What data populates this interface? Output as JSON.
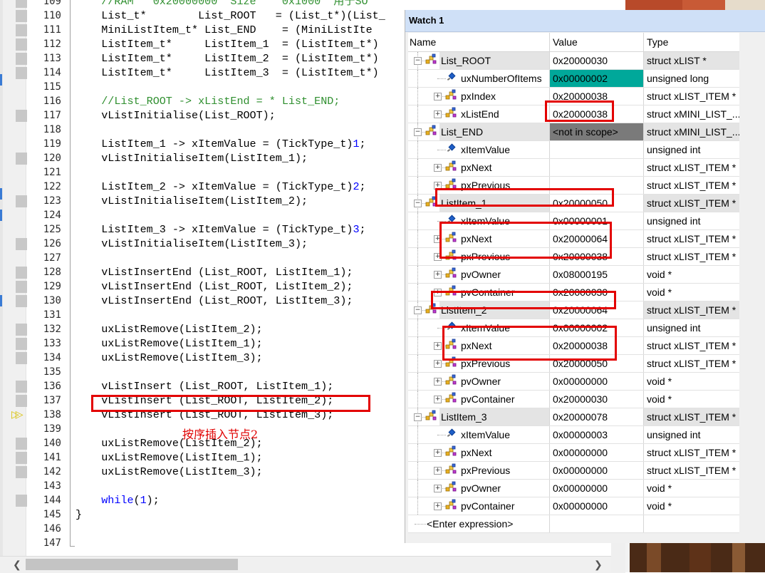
{
  "editor": {
    "lines": [
      {
        "n": "109",
        "code": [
          {
            "t": "    //RAM   0x20000000  Size    0x1000  用于SO",
            "c": "cm"
          }
        ]
      },
      {
        "n": "110",
        "code": [
          {
            "t": "    List_t*        List_ROOT   = (List_t*)(List_"
          }
        ]
      },
      {
        "n": "111",
        "code": [
          {
            "t": "    MiniListItem_t* List_END    = (MiniListIte"
          }
        ]
      },
      {
        "n": "112",
        "code": [
          {
            "t": "    ListItem_t*     ListItem_1  = (ListItem_t*)"
          }
        ]
      },
      {
        "n": "113",
        "code": [
          {
            "t": "    ListItem_t*     ListItem_2  = (ListItem_t*)"
          }
        ]
      },
      {
        "n": "114",
        "code": [
          {
            "t": "    ListItem_t*     ListItem_3  = (ListItem_t*)"
          }
        ]
      },
      {
        "n": "115",
        "code": [
          {
            "t": ""
          }
        ]
      },
      {
        "n": "116",
        "code": [
          {
            "t": "    //List_ROOT -> xListEnd = * List_END;",
            "c": "cm"
          }
        ]
      },
      {
        "n": "117",
        "code": [
          {
            "t": "    vListInitialise(List_ROOT);"
          }
        ]
      },
      {
        "n": "118",
        "code": [
          {
            "t": ""
          }
        ]
      },
      {
        "n": "119",
        "code": [
          {
            "t": "    ListItem_1 -> xItemValue = (TickType_t)"
          },
          {
            "t": "1",
            "c": "num"
          },
          {
            "t": ";"
          }
        ]
      },
      {
        "n": "120",
        "code": [
          {
            "t": "    vListInitialiseItem(ListItem_1);"
          }
        ]
      },
      {
        "n": "121",
        "code": [
          {
            "t": ""
          }
        ]
      },
      {
        "n": "122",
        "code": [
          {
            "t": "    ListItem_2 -> xItemValue = (TickType_t)"
          },
          {
            "t": "2",
            "c": "num"
          },
          {
            "t": ";"
          }
        ]
      },
      {
        "n": "123",
        "code": [
          {
            "t": "    vListInitialiseItem(ListItem_2);"
          }
        ]
      },
      {
        "n": "124",
        "code": [
          {
            "t": ""
          }
        ]
      },
      {
        "n": "125",
        "code": [
          {
            "t": "    ListItem_3 -> xItemValue = (TickType_t)"
          },
          {
            "t": "3",
            "c": "num"
          },
          {
            "t": ";"
          }
        ]
      },
      {
        "n": "126",
        "code": [
          {
            "t": "    vListInitialiseItem(ListItem_3);"
          }
        ]
      },
      {
        "n": "127",
        "code": [
          {
            "t": ""
          }
        ]
      },
      {
        "n": "128",
        "code": [
          {
            "t": "    vListInsertEnd (List_ROOT, ListItem_1);"
          }
        ]
      },
      {
        "n": "129",
        "code": [
          {
            "t": "    vListInsertEnd (List_ROOT, ListItem_2);"
          }
        ]
      },
      {
        "n": "130",
        "code": [
          {
            "t": "    vListInsertEnd (List_ROOT, ListItem_3);"
          }
        ]
      },
      {
        "n": "131",
        "code": [
          {
            "t": ""
          }
        ]
      },
      {
        "n": "132",
        "code": [
          {
            "t": "    uxListRemove(ListItem_2);"
          }
        ]
      },
      {
        "n": "133",
        "code": [
          {
            "t": "    uxListRemove(ListItem_1);"
          }
        ]
      },
      {
        "n": "134",
        "code": [
          {
            "t": "    uxListRemove(ListItem_3);"
          }
        ]
      },
      {
        "n": "135",
        "code": [
          {
            "t": ""
          }
        ]
      },
      {
        "n": "136",
        "code": [
          {
            "t": "    vListInsert (List_ROOT, ListItem_1);"
          }
        ]
      },
      {
        "n": "137",
        "code": [
          {
            "t": "    vListInsert (List_ROOT, ListItem_2);"
          }
        ]
      },
      {
        "n": "138",
        "code": [
          {
            "t": "    vListInsert (List_ROOT, ListItem_3);"
          }
        ]
      },
      {
        "n": "139",
        "code": [
          {
            "t": ""
          }
        ]
      },
      {
        "n": "140",
        "code": [
          {
            "t": "    uxListRemove(ListItem_2);"
          }
        ]
      },
      {
        "n": "141",
        "code": [
          {
            "t": "    uxListRemove(ListItem_1);"
          }
        ]
      },
      {
        "n": "142",
        "code": [
          {
            "t": "    uxListRemove(ListItem_3);"
          }
        ]
      },
      {
        "n": "143",
        "code": [
          {
            "t": ""
          }
        ]
      },
      {
        "n": "144",
        "code": [
          {
            "t": "    "
          },
          {
            "t": "while",
            "c": "kw"
          },
          {
            "t": "("
          },
          {
            "t": "1",
            "c": "num"
          },
          {
            "t": ");"
          }
        ]
      },
      {
        "n": "145",
        "code": [
          {
            "t": "}"
          }
        ]
      },
      {
        "n": "146",
        "code": [
          {
            "t": ""
          }
        ]
      },
      {
        "n": "147",
        "code": [
          {
            "t": ""
          }
        ]
      }
    ],
    "annotation": "按序插入节点2"
  },
  "watch": {
    "title": "Watch 1",
    "columns": {
      "name": "Name",
      "value": "Value",
      "type": "Type"
    },
    "rows": [
      {
        "level": 0,
        "name": "List_ROOT",
        "value": "0x20000030",
        "type": "struct xLIST *",
        "exp": "-",
        "icon": "struct"
      },
      {
        "level": 1,
        "name": "uxNumberOfItems",
        "value": "0x00000002",
        "type": "unsigned long",
        "icon": "field",
        "vstyle": "teal"
      },
      {
        "level": 1,
        "name": "pxIndex",
        "value": "0x20000038",
        "type": "struct xLIST_ITEM *",
        "exp": "+",
        "icon": "struct"
      },
      {
        "level": 1,
        "name": "xListEnd",
        "value": "0x20000038",
        "type": "struct xMINI_LIST_...",
        "exp": "+",
        "icon": "struct"
      },
      {
        "level": 0,
        "name": "List_END",
        "value": "<not in scope>",
        "type": "struct xMINI_LIST_...",
        "exp": "-",
        "icon": "struct",
        "vstyle": "gray"
      },
      {
        "level": 1,
        "name": "xItemValue",
        "value": "",
        "type": "unsigned int",
        "icon": "field"
      },
      {
        "level": 1,
        "name": "pxNext",
        "value": "",
        "type": "struct xLIST_ITEM *",
        "exp": "+",
        "icon": "struct"
      },
      {
        "level": 1,
        "name": "pxPrevious",
        "value": "",
        "type": "struct xLIST_ITEM *",
        "exp": "+",
        "icon": "struct"
      },
      {
        "level": 0,
        "name": "ListItem_1",
        "value": "0x20000050",
        "type": "struct xLIST_ITEM *",
        "exp": "-",
        "icon": "struct"
      },
      {
        "level": 1,
        "name": "xItemValue",
        "value": "0x00000001",
        "type": "unsigned int",
        "icon": "field"
      },
      {
        "level": 1,
        "name": "pxNext",
        "value": "0x20000064",
        "type": "struct xLIST_ITEM *",
        "exp": "+",
        "icon": "struct"
      },
      {
        "level": 1,
        "name": "pxPrevious",
        "value": "0x20000038",
        "type": "struct xLIST_ITEM *",
        "exp": "+",
        "icon": "struct"
      },
      {
        "level": 1,
        "name": "pvOwner",
        "value": "0x08000195",
        "type": "void *",
        "exp": "+",
        "icon": "struct"
      },
      {
        "level": 1,
        "name": "pvContainer",
        "value": "0x20000030",
        "type": "void *",
        "exp": "+",
        "icon": "struct"
      },
      {
        "level": 0,
        "name": "ListItem_2",
        "value": "0x20000064",
        "type": "struct xLIST_ITEM *",
        "exp": "-",
        "icon": "struct"
      },
      {
        "level": 1,
        "name": "xItemValue",
        "value": "0x00000002",
        "type": "unsigned int",
        "icon": "field"
      },
      {
        "level": 1,
        "name": "pxNext",
        "value": "0x20000038",
        "type": "struct xLIST_ITEM *",
        "exp": "+",
        "icon": "struct"
      },
      {
        "level": 1,
        "name": "pxPrevious",
        "value": "0x20000050",
        "type": "struct xLIST_ITEM *",
        "exp": "+",
        "icon": "struct"
      },
      {
        "level": 1,
        "name": "pvOwner",
        "value": "0x00000000",
        "type": "void *",
        "exp": "+",
        "icon": "struct"
      },
      {
        "level": 1,
        "name": "pvContainer",
        "value": "0x20000030",
        "type": "void *",
        "exp": "+",
        "icon": "struct"
      },
      {
        "level": 0,
        "name": "ListItem_3",
        "value": "0x20000078",
        "type": "struct xLIST_ITEM *",
        "exp": "-",
        "icon": "struct"
      },
      {
        "level": 1,
        "name": "xItemValue",
        "value": "0x00000003",
        "type": "unsigned int",
        "icon": "field"
      },
      {
        "level": 1,
        "name": "pxNext",
        "value": "0x00000000",
        "type": "struct xLIST_ITEM *",
        "exp": "+",
        "icon": "struct"
      },
      {
        "level": 1,
        "name": "pxPrevious",
        "value": "0x00000000",
        "type": "struct xLIST_ITEM *",
        "exp": "+",
        "icon": "struct"
      },
      {
        "level": 1,
        "name": "pvOwner",
        "value": "0x00000000",
        "type": "void *",
        "exp": "+",
        "icon": "struct"
      },
      {
        "level": 1,
        "name": "pvContainer",
        "value": "0x00000000",
        "type": "void *",
        "exp": "+",
        "icon": "struct"
      }
    ],
    "enter_expression": "<Enter expression>"
  },
  "colors": {
    "highlight_red": "#e30000",
    "comment_green": "#2f8f2f",
    "keyword_blue": "#0000ff",
    "changed_value_teal": "#00a89a"
  }
}
